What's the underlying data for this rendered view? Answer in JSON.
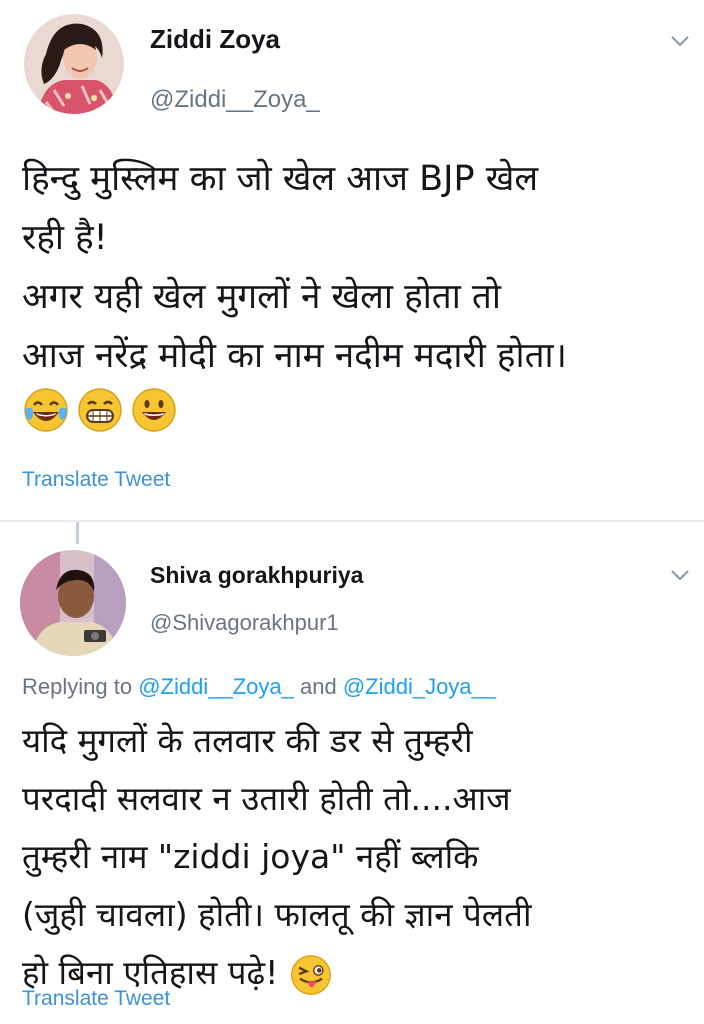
{
  "tweets": [
    {
      "name": "Ziddi Zoya",
      "handle": "@Ziddi__Zoya_",
      "lines": [
        "हिन्दु मुस्लिम का जो खेल आज BJP खेल",
        "रही है!",
        " अगर यही खेल मुगलों ने खेला होता तो",
        "आज नरेंद्र मोदी का नाम नदीम मदारी होता।"
      ],
      "emojis": [
        "tears-of-joy-emoji",
        "grinning-squint-emoji",
        "smiley-emoji"
      ],
      "translate_label": "Translate Tweet"
    },
    {
      "name": "Shiva gorakhpuriya",
      "handle": "@Shivagorakhpur1",
      "replying_prefix": "Replying to",
      "replying_mention_1": "@Ziddi__Zoya_",
      "replying_and": "and",
      "replying_mention_2": "@Ziddi_Joya__",
      "lines": [
        "यदि मुगलों के तलवार की डर से तुम्हरी",
        "परदादी सलवार न उतारी होती तो....आज",
        "तुम्हरी नाम \"ziddi joya\" नहीं ब्लकि",
        " (जुही चावला) होती। फालतू की ज्ञान पेलती",
        "हो बिना एतिहास पढ़े!"
      ],
      "emojis": [
        "winking-tongue-emoji"
      ],
      "translate_label": "Translate Tweet"
    }
  ],
  "colors": {
    "name": "#14171a",
    "handle": "#657786",
    "link": "#3b94d9",
    "mention": "#1da1f2",
    "separator": "#e6ecf0"
  }
}
